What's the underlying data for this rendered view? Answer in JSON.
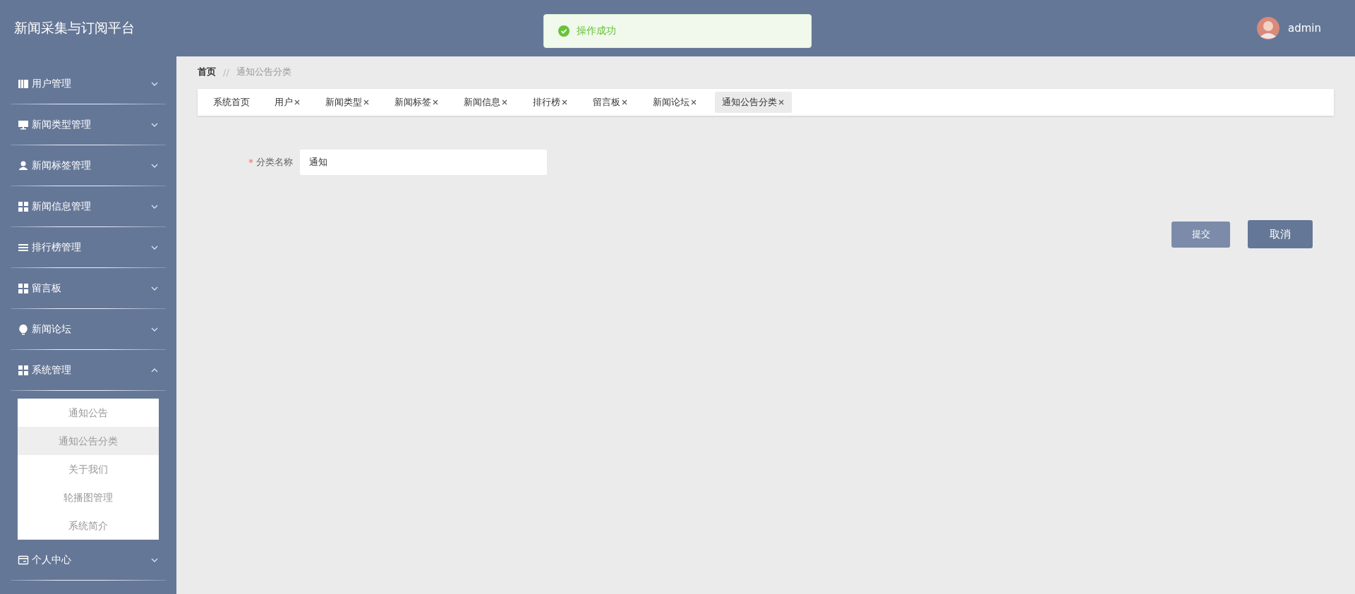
{
  "header": {
    "title": "新闻采集与订阅平台",
    "user": "admin"
  },
  "toast": {
    "kind": "success",
    "text": "操作成功"
  },
  "sidebar": {
    "items": [
      {
        "label": "用户管理",
        "expanded": false
      },
      {
        "label": "新闻类型管理",
        "expanded": false
      },
      {
        "label": "新闻标签管理",
        "expanded": false
      },
      {
        "label": "新闻信息管理",
        "expanded": false
      },
      {
        "label": "排行榜管理",
        "expanded": false
      },
      {
        "label": "留言板",
        "expanded": false
      },
      {
        "label": "新闻论坛",
        "expanded": false
      },
      {
        "label": "系统管理",
        "expanded": true,
        "children": [
          {
            "label": "通知公告",
            "selected": false
          },
          {
            "label": "通知公告分类",
            "selected": true
          },
          {
            "label": "关于我们",
            "selected": false
          },
          {
            "label": "轮播图管理",
            "selected": false
          },
          {
            "label": "系统简介",
            "selected": false
          }
        ]
      },
      {
        "label": "个人中心",
        "expanded": false
      }
    ]
  },
  "breadcrumb": {
    "separator": "//",
    "items": [
      "首页",
      "通知公告分类"
    ]
  },
  "tabs": [
    {
      "label": "系统首页",
      "closable": false,
      "selected": false
    },
    {
      "label": "用户",
      "closable": true,
      "selected": false
    },
    {
      "label": "新闻类型",
      "closable": true,
      "selected": false
    },
    {
      "label": "新闻标签",
      "closable": true,
      "selected": false
    },
    {
      "label": "新闻信息",
      "closable": true,
      "selected": false
    },
    {
      "label": "排行榜",
      "closable": true,
      "selected": false
    },
    {
      "label": "留言板",
      "closable": true,
      "selected": false
    },
    {
      "label": "新闻论坛",
      "closable": true,
      "selected": false
    },
    {
      "label": "通知公告分类",
      "closable": true,
      "selected": true
    }
  ],
  "form": {
    "fields": [
      {
        "label": "分类名称",
        "required_mark": "*",
        "value": "通知"
      }
    ],
    "buttons": [
      {
        "label": "提交",
        "kind": "submit"
      },
      {
        "label": "取消",
        "kind": "cancel"
      }
    ]
  }
}
